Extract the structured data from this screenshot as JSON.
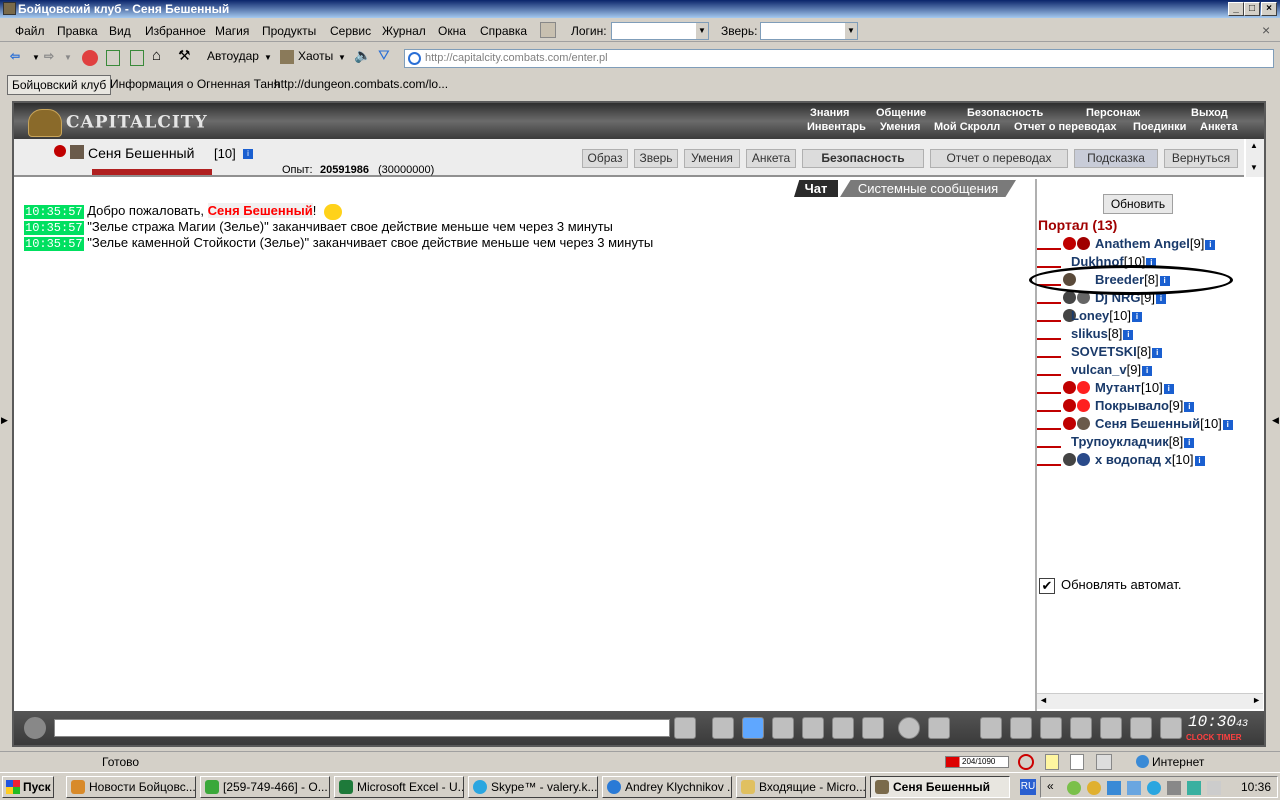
{
  "window": {
    "title": "Бойцовский клуб - Сеня Бешенный"
  },
  "menu": {
    "items": [
      "Файл",
      "Правка",
      "Вид",
      "Избранное",
      "Магия",
      "Продукты",
      "Сервис",
      "Журнал",
      "Окна",
      "Справка"
    ],
    "login_label": "Логин:",
    "pet_label": "Зверь:"
  },
  "toolbar": {
    "autoudar": "Автоудар",
    "haoty": "Хаоты",
    "address": "http://capitalcity.combats.com/enter.pl"
  },
  "links": [
    "Бойцовский клуб",
    "Информация о Огненная Таня",
    "http://dungeon.combats.com/lo..."
  ],
  "header": {
    "logo": "CAPITALCITY",
    "nav1": [
      "Знания",
      "Общение",
      "Безопасность",
      "Персонаж",
      "Выход"
    ],
    "nav2": [
      "Инвентарь",
      "Умения",
      "Мой Скролл",
      "Отчет о переводах",
      "Поединки",
      "Анкета"
    ]
  },
  "character": {
    "name": "Сеня Бешенный",
    "level": "[10]",
    "exp_label": "Опыт:",
    "exp_value": "20591986",
    "exp_next": "(30000000)"
  },
  "charbuttons": [
    "Образ",
    "Зверь",
    "Умения",
    "Анкета",
    "Безопасность",
    "Отчет о переводах",
    "Подсказка",
    "Вернуться"
  ],
  "tabs": {
    "chat": "Чат",
    "system": "Системные сообщения"
  },
  "chat": [
    {
      "time": "10:35:57",
      "pre": "Добро пожаловать, ",
      "nick": "Сеня Бешенный",
      "post": "!"
    },
    {
      "time": "10:35:57",
      "pre": "\"Зелье стража Магии (Зелье)\" заканчивает свое действие меньше чем через 3 минуты"
    },
    {
      "time": "10:35:57",
      "pre": "\"Зелье каменной Стойкости (Зелье)\" заканчивает свое действие меньше чем через 3 минуты"
    }
  ],
  "rightpanel": {
    "refresh": "Обновить",
    "portal": "Портал (13)",
    "auto": "Обновлять автомат."
  },
  "users": [
    {
      "name": "Anathem Angel",
      "lvl": "[9]"
    },
    {
      "name": "Dukhnof",
      "lvl": "[10]"
    },
    {
      "name": "Breeder",
      "lvl": "[8]"
    },
    {
      "name": "Dj NRG",
      "lvl": "[9]"
    },
    {
      "name": "Loney",
      "lvl": "[10]"
    },
    {
      "name": "slikus",
      "lvl": "[8]"
    },
    {
      "name": "SOVETSKI",
      "lvl": "[8]"
    },
    {
      "name": "vulcan_v",
      "lvl": "[9]"
    },
    {
      "name": "Мутант",
      "lvl": "[10]"
    },
    {
      "name": "Покрывало",
      "lvl": "[9]"
    },
    {
      "name": "Сеня Бешенный",
      "lvl": "[10]"
    },
    {
      "name": "Трупоукладчик",
      "lvl": "[8]"
    },
    {
      "name": "х водопад х",
      "lvl": "[10]"
    }
  ],
  "clock": {
    "time": "10:30",
    "sec": "43",
    "labels": "CLOCK TIMER"
  },
  "status": {
    "text": "Готово",
    "zone": "Интернет",
    "hp": "204/1090"
  },
  "taskbar": {
    "start": "Пуск",
    "tasks": [
      "Новости Бойцовс...",
      "[259-749-466] - О...",
      "Microsoft Excel - U...",
      "Skype™ - valery.k...",
      "Andrey Klychnikov ...",
      "Входящие - Micro...",
      "Сеня Бешенный"
    ],
    "lang": "RU",
    "time": "10:36"
  }
}
